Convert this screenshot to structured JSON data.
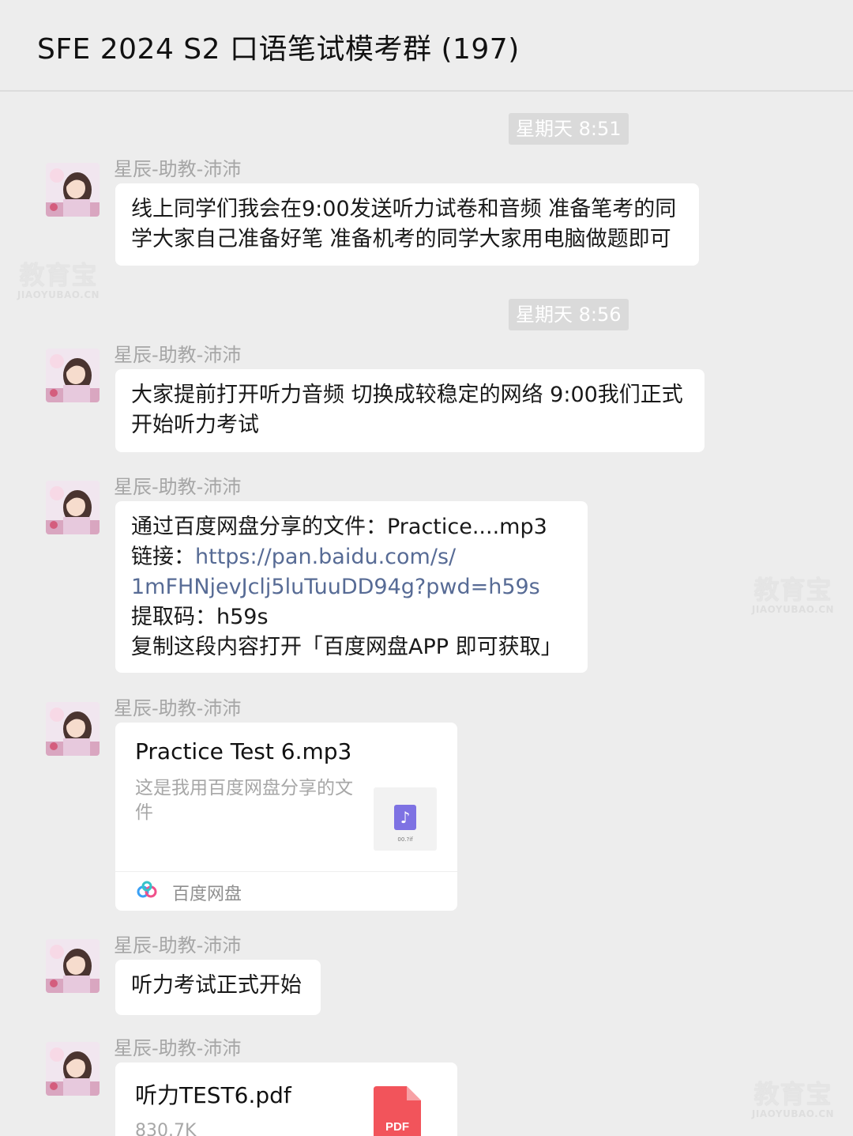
{
  "header": {
    "title": "SFE 2024 S2 口语笔试模考群 (197)"
  },
  "timestamps": [
    "星期天 8:51",
    "星期天 8:56"
  ],
  "sender": "星辰-助教-沛沛",
  "messages": [
    {
      "lines": [
        "线上同学们我会在9:00发送听力试卷和音频 准备笔考的同",
        "学大家自己准备好笔 准备机考的同学大家用电脑做题即可"
      ]
    },
    {
      "lines": [
        "大家提前打开听力音频 切换成较稳定的网络 9:00我们正式",
        "开始听力考试"
      ]
    },
    {
      "share": {
        "line1": "通过百度网盘分享的文件：Practice....mp3",
        "link_prefix": "链接：",
        "link_part1": "https://pan.baidu.com/s/",
        "link_part2": "1mFHNjevJclj5luTuuDD94g?pwd=h59s",
        "code": "提取码：h59s",
        "copy": "复制这段内容打开「百度网盘APP 即可获取」"
      }
    },
    {
      "card": {
        "title": "Practice Test 6.mp3",
        "desc": "这是我用百度网盘分享的文件",
        "thumb_caption": "00.?if",
        "source": "百度网盘"
      }
    },
    {
      "lines": [
        "听力考试正式开始"
      ]
    },
    {
      "file": {
        "name": "听力TEST6.pdf",
        "size": "830.7K",
        "icon_label": "PDF"
      }
    }
  ],
  "watermark": {
    "top": "教育宝",
    "bottom": "JIAOYUBAO.CN"
  }
}
